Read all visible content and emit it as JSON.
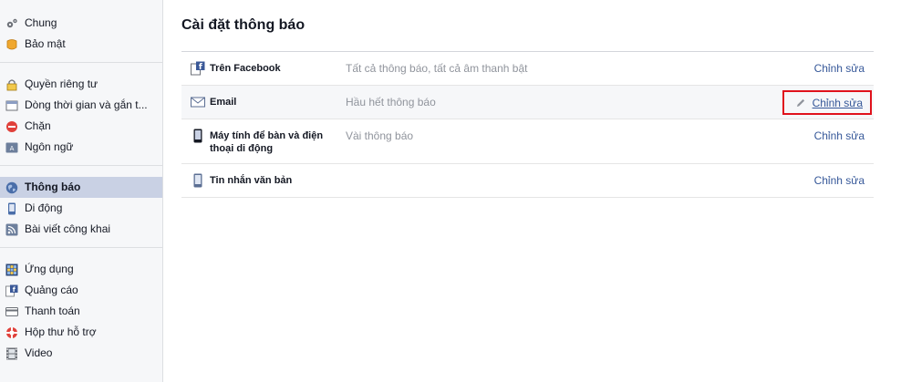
{
  "sidebar": {
    "groups": [
      {
        "items": [
          {
            "label": "Chung",
            "icon": "gears-icon"
          },
          {
            "label": "Bảo mật",
            "icon": "badge-icon"
          }
        ]
      },
      {
        "items": [
          {
            "label": "Quyền riêng tư",
            "icon": "lock-icon"
          },
          {
            "label": "Dòng thời gian và gắn t...",
            "icon": "timeline-icon"
          },
          {
            "label": "Chặn",
            "icon": "block-icon"
          },
          {
            "label": "Ngôn ngữ",
            "icon": "language-icon"
          }
        ]
      },
      {
        "items": [
          {
            "label": "Thông báo",
            "icon": "globe-icon",
            "active": true
          },
          {
            "label": "Di động",
            "icon": "mobile-icon"
          },
          {
            "label": "Bài viết công khai",
            "icon": "rss-icon"
          }
        ]
      },
      {
        "items": [
          {
            "label": "Ứng dụng",
            "icon": "apps-icon"
          },
          {
            "label": "Quảng cáo",
            "icon": "ads-icon"
          },
          {
            "label": "Thanh toán",
            "icon": "card-icon"
          },
          {
            "label": "Hộp thư hỗ trợ",
            "icon": "lifebuoy-icon"
          },
          {
            "label": "Video",
            "icon": "film-icon"
          }
        ]
      }
    ]
  },
  "main": {
    "title": "Cài đặt thông báo",
    "rows": [
      {
        "label": "Trên Facebook",
        "value": "Tất cả thông báo, tất cả âm thanh bật",
        "edit": "Chỉnh sửa",
        "icon": "facebook-icon"
      },
      {
        "label": "Email",
        "value": "Hầu hết thông báo",
        "edit": "Chỉnh sửa",
        "icon": "envelope-icon",
        "highlighted": true
      },
      {
        "label": "Máy tính để bàn và điện thoại di động",
        "value": "Vài thông báo",
        "edit": "Chỉnh sửa",
        "icon": "phone-icon"
      },
      {
        "label": "Tin nhắn văn bản",
        "value": "",
        "edit": "Chỉnh sửa",
        "icon": "sms-icon"
      }
    ]
  },
  "colors": {
    "link": "#365899",
    "highlight_border": "#e0121c",
    "active_bg": "#c9d1e4"
  }
}
